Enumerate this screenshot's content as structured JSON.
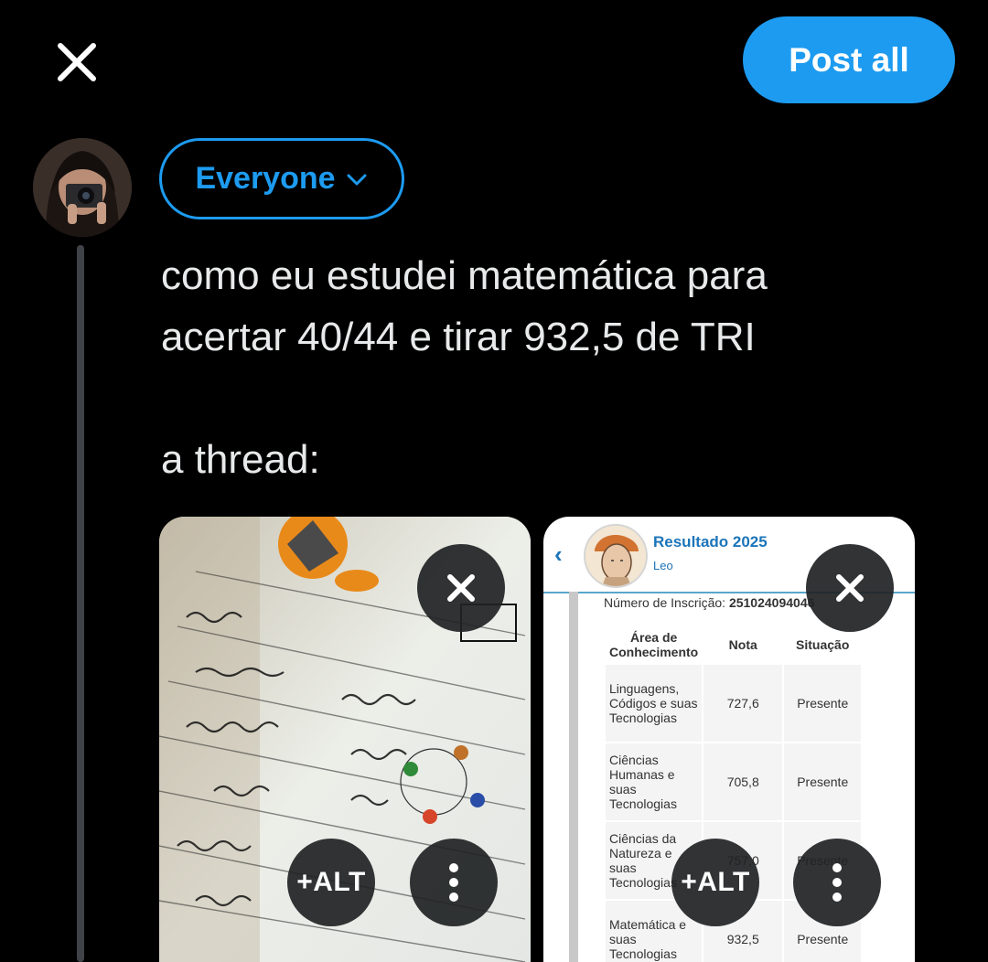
{
  "header": {
    "post_all_label": "Post all"
  },
  "composer": {
    "audience_label": "Everyone",
    "tweet_text": "como eu estudei matemática para\nacertar 40/44 e tirar 932,5 de TRI\n\na thread:"
  },
  "media": [
    {
      "alt_button_label": "+ALT"
    },
    {
      "alt_button_label": "+ALT",
      "screenshot": {
        "title": "Resultado 2025",
        "name": "Leo",
        "inscricao_label": "Número de Inscrição:",
        "inscricao_value": "251024094046",
        "columns": [
          "Área de Conhecimento",
          "Nota",
          "Situação"
        ],
        "rows": [
          {
            "area": "Linguagens, Códigos e suas Tecnologias",
            "nota": "727,6",
            "situacao": "Presente"
          },
          {
            "area": "Ciências Humanas e suas Tecnologias",
            "nota": "705,8",
            "situacao": "Presente"
          },
          {
            "area": "Ciências da Natureza e suas Tecnologias",
            "nota": "757,0",
            "situacao": "Presente"
          },
          {
            "area": "Matemática e suas Tecnologias",
            "nota": "932,5",
            "situacao": "Presente"
          }
        ]
      }
    }
  ],
  "colors": {
    "accent": "#1d9bf0",
    "background": "#000000",
    "text": "#e7e9ea"
  }
}
